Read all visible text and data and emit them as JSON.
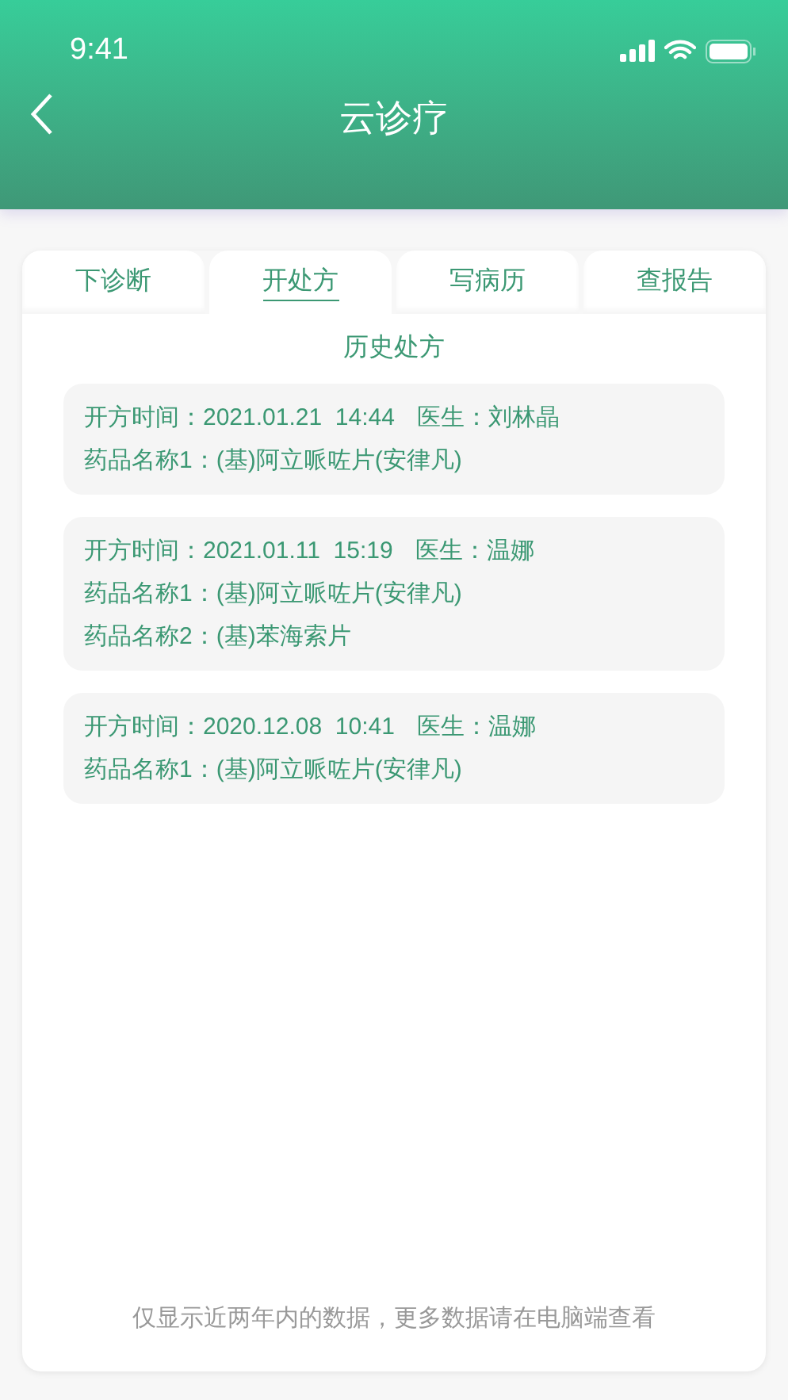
{
  "status_bar": {
    "time": "9:41"
  },
  "header": {
    "title": "云诊疗"
  },
  "tabs": [
    {
      "label": "下诊断",
      "selected": false
    },
    {
      "label": "开处方",
      "selected": true
    },
    {
      "label": "写病历",
      "selected": false
    },
    {
      "label": "查报告",
      "selected": false
    }
  ],
  "section_title": "历史处方",
  "prescriptions": [
    {
      "time": "开方时间：2021.01.21  14:44",
      "doctor": "医生：刘林晶",
      "drugs": [
        "药品名称1：(基)阿立哌咗片(安律凡)"
      ]
    },
    {
      "time": "开方时间：2021.01.11  15:19",
      "doctor": "医生：温娜",
      "drugs": [
        "药品名称1：(基)阿立哌咗片(安律凡)",
        "药品名称2：(基)苯海索片"
      ]
    },
    {
      "time": "开方时间：2020.12.08  10:41",
      "doctor": "医生：温娜",
      "drugs": [
        "药品名称1：(基)阿立哌咗片(安律凡)"
      ]
    }
  ],
  "footer_note": "仅显示近两年内的数据，更多数据请在电脑端查看"
}
